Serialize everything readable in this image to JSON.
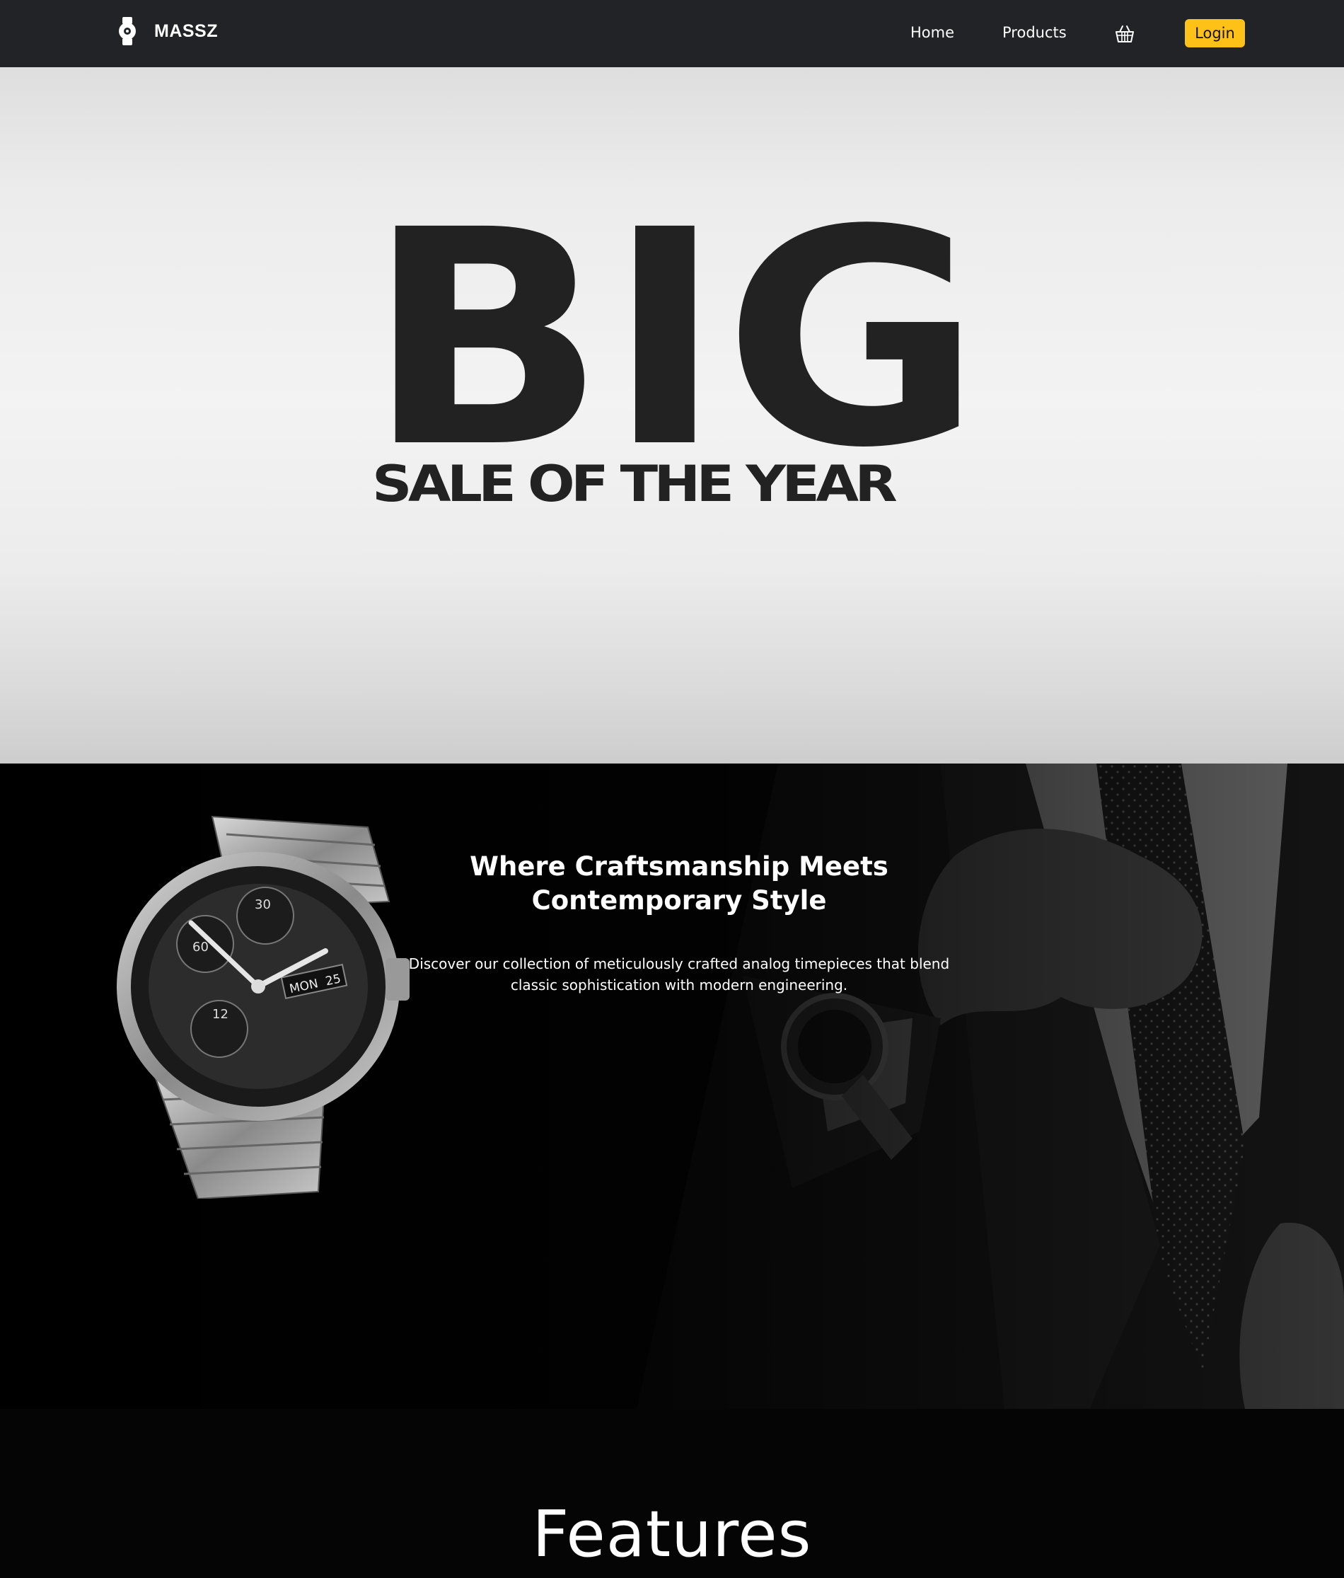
{
  "nav": {
    "brand": "MASSZ",
    "links": [
      "Home",
      "Products"
    ],
    "login_label": "Login",
    "accent_color": "#fdc117",
    "bg_color": "#212327"
  },
  "hero": {
    "headline": "BIG",
    "subheadline": "SALE OF THE YEAR"
  },
  "style_section": {
    "title": "Where Craftsmanship Meets Contemporary Style",
    "description": "Discover our collection of meticulously crafted analog timepieces that blend classic sophistication with modern engineering."
  },
  "watch": {
    "day": "MON",
    "date": "25"
  },
  "features": {
    "title": "Features"
  },
  "icons": {
    "logo": "watch-logo-icon",
    "cart": "basket-icon"
  }
}
